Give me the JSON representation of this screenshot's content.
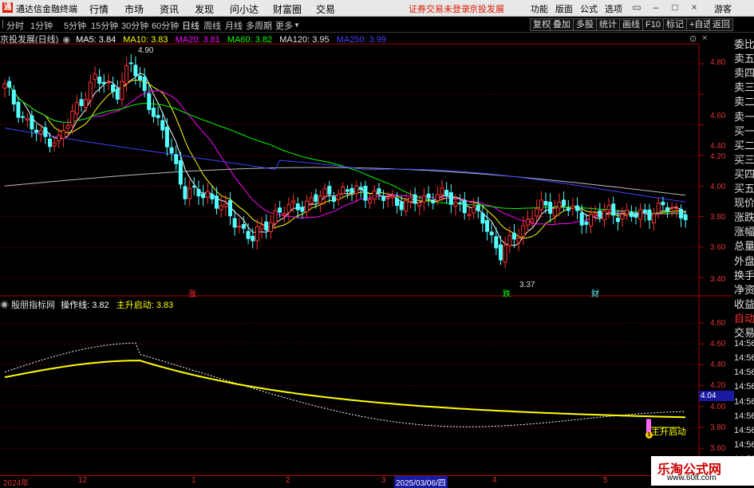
{
  "titlebar": {
    "app_title": "通达信金融终端",
    "menus": [
      "行情",
      "市场",
      "资讯",
      "发现",
      "问小达",
      "财富圈",
      "交易"
    ],
    "warning": "证券交易未登录",
    "stock_name": "京投发展",
    "right_menus": [
      "功能",
      "版面",
      "公式",
      "选项"
    ],
    "guest": "游客"
  },
  "periodbar": {
    "periods": [
      "分时",
      "1分钟",
      "5分钟",
      "15分钟",
      "30分钟",
      "60分钟",
      "日线",
      "周线",
      "月线",
      "多周期",
      "更多"
    ],
    "active": "日线",
    "tools": [
      "复权",
      "叠加",
      "多股",
      "统计",
      "画线",
      "F10",
      "标记",
      "+自选",
      "返回"
    ]
  },
  "main_header": {
    "name": "京投发展(日线)",
    "ma": [
      {
        "label": "MA5: 3.84",
        "color": "#ffffff"
      },
      {
        "label": "MA10: 3.83",
        "color": "#ffff00"
      },
      {
        "label": "MA20: 3.81",
        "color": "#ff00ff"
      },
      {
        "label": "MA60: 3.82",
        "color": "#00ff00"
      },
      {
        "label": "MA120: 3.95",
        "color": "#e0e0e0"
      },
      {
        "label": "MA250: 3.99",
        "color": "#4040ff"
      }
    ]
  },
  "sub_header": {
    "name": "殷朋指标网",
    "line1": "操作线: 3.82",
    "line2": "主升启动: 3.83"
  },
  "price_axis": [
    "4.80",
    "4.60",
    "4.40",
    "4.20",
    "4.00",
    "3.80",
    "3.60",
    "3.40"
  ],
  "sub_axis": [
    "4.80",
    "4.60",
    "4.40",
    "4.20",
    "4.00",
    "3.80",
    "3.60"
  ],
  "annotations": {
    "high": "4.90",
    "low": "3.37",
    "zhang": "涨",
    "die": "跌",
    "cai": "财",
    "sub_value": "4.04",
    "signal": "主升启动"
  },
  "right_panel": {
    "items": [
      "委比",
      "卖五",
      "卖四",
      "卖三",
      "卖二",
      "卖一",
      "买一",
      "买二",
      "买三",
      "买四",
      "买五",
      "现价",
      "涨跌",
      "涨幅",
      "总量",
      "外盘",
      "换手",
      "净资",
      "收益",
      "自动",
      "交易",
      "14:56",
      "14:56",
      "14:56",
      "14:56",
      "14:56",
      "14:56",
      "14:56",
      "14:56",
      "14:56"
    ]
  },
  "x_axis": [
    "2024年",
    "12",
    "1",
    "2",
    "3",
    "2025/03/06/四",
    "4",
    "5"
  ],
  "watermark": {
    "title": "乐淘公式网",
    "url": "www.60lt.com"
  },
  "colors": {
    "up": "#ff3232",
    "down": "#54ffff",
    "accent": "#d81e06"
  }
}
